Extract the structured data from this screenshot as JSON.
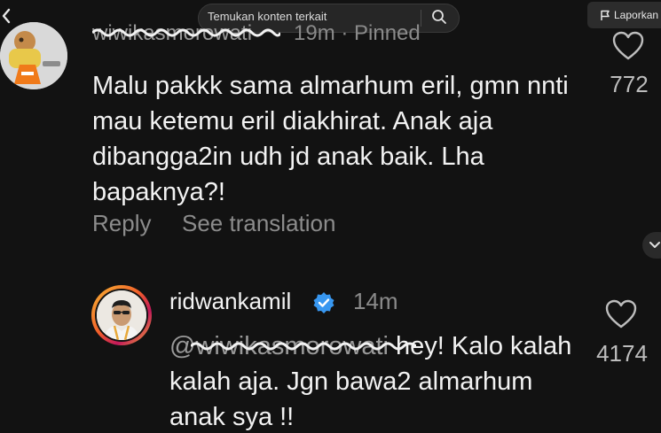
{
  "search": {
    "text": "Temukan konten terkait"
  },
  "report": {
    "label": "Laporkan"
  },
  "comments": [
    {
      "username": "wiwikasmorowati",
      "meta": "19m · Pinned",
      "text": "Malu pakkk sama almarhum eril, gmn nnti mau ketemu eril diakhirat. Anak aja dibangga2in udh jd anak baik. Lha bapaknya?!",
      "likes": "772",
      "reply_label": "Reply",
      "translate_label": "See translation"
    }
  ],
  "reply": {
    "username": "ridwankamil",
    "time": "14m",
    "mention": "@wiwikasmorowati",
    "text": " hey! Kalo kalah kalah aja. Jgn bawa2 almarhum anak sya !!",
    "likes": "4174"
  },
  "colors": {
    "background": "#121212",
    "verified_badge": "#3897f0"
  }
}
